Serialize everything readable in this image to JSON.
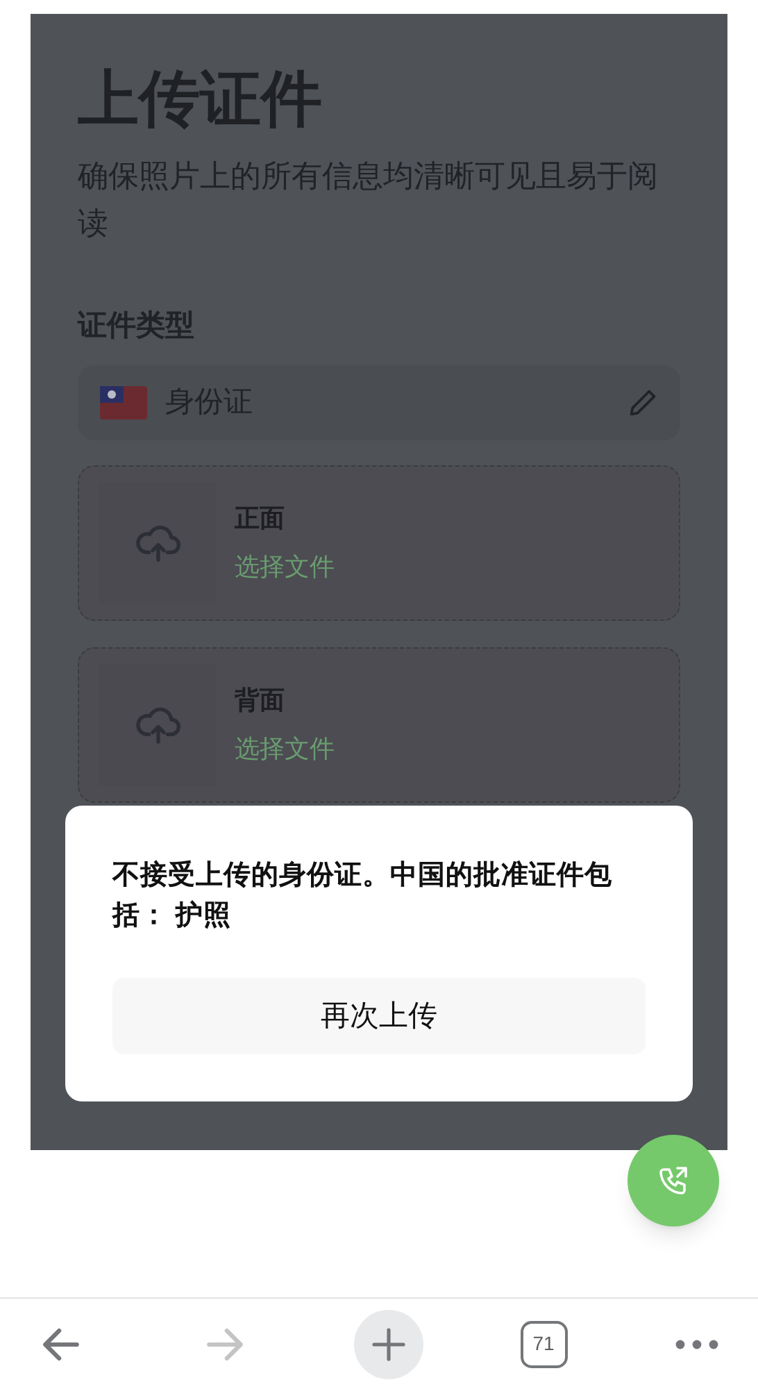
{
  "page": {
    "title": "上传证件",
    "subtitle": "确保照片上的所有信息均清晰可见且易于阅读"
  },
  "document_type": {
    "label": "证件类型",
    "value": "身份证"
  },
  "uploads": [
    {
      "label": "正面",
      "action": "选择文件"
    },
    {
      "label": "背面",
      "action": "选择文件"
    }
  ],
  "dialog": {
    "message": "不接受上传的身份证。中国的批准证件包括： 护照",
    "button": "再次上传"
  },
  "browser_bar": {
    "back_disabled": false,
    "forward_disabled": true,
    "tab_count": "71"
  }
}
